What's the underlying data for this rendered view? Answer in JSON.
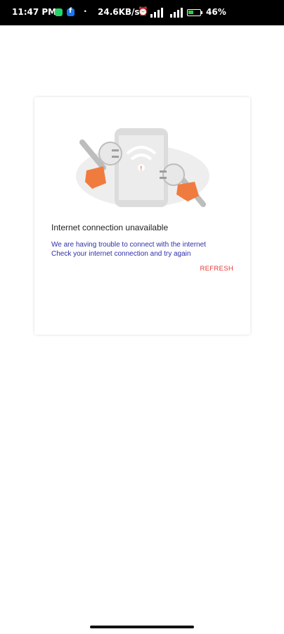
{
  "status_bar": {
    "time": "11:47 PM",
    "network_speed": "24.6KB/s",
    "battery_percent": "46",
    "battery_level": 0.46,
    "icons": [
      "whatsapp-icon",
      "facebook-icon",
      "alarm-icon",
      "signal-icon",
      "battery-icon"
    ]
  },
  "error": {
    "title": "Internet connection unavailable",
    "message_line1": "We are having trouble to connect with the internet",
    "message_line2": "Check your internet connection and try again",
    "refresh_label": "REFRESH",
    "illustration_icon": "unplugged-cable-phone-illustration"
  },
  "colors": {
    "status_bar_bg": "#000000",
    "title": "#222222",
    "message": "#2f2fa8",
    "refresh": "#e53935",
    "hand": "#f07b3f",
    "battery": "#2ecc40"
  }
}
